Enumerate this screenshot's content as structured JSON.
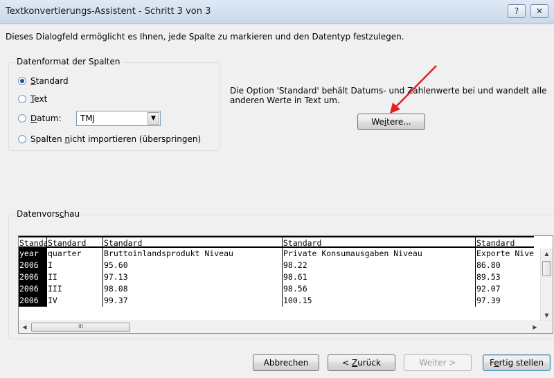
{
  "window": {
    "title": "Textkonvertierungs-Assistent - Schritt 3 von 3",
    "help_label": "?",
    "close_label": "✕"
  },
  "intro": "Dieses Dialogfeld ermöglicht es Ihnen, jede Spalte zu markieren und den Datentyp festzulegen.",
  "format_group": {
    "legend": "Datenformat der Spalten",
    "options": [
      {
        "pre": "",
        "key": "S",
        "post": "tandard",
        "selected": true
      },
      {
        "pre": "",
        "key": "T",
        "post": "ext",
        "selected": false
      },
      {
        "pre": "",
        "key": "D",
        "post": "atum:",
        "selected": false
      },
      {
        "pre": "Spalten ",
        "key": "n",
        "post": "icht importieren (überspringen)",
        "selected": false
      }
    ],
    "date_format": "TMJ"
  },
  "info_text": "Die Option 'Standard' behält Datums- und Zahlenwerte bei und wandelt alle anderen Werte in Text um.",
  "more_button": {
    "pre": "We",
    "key": "i",
    "post": "tere..."
  },
  "preview_group": {
    "pre": "Datenvors",
    "key": "c",
    "post": "hau"
  },
  "preview": {
    "headers": [
      "Standard",
      "Standard",
      "Standard",
      "Standard",
      "Standard"
    ],
    "rows": [
      [
        "year",
        "quarter",
        "Bruttoinlandsprodukt Niveau",
        "Private Konsumausgaben Niveau",
        "Exporte Niveau"
      ],
      [
        "2006",
        "I",
        "95.60",
        "98.22",
        "86.80"
      ],
      [
        "2006",
        "II",
        "97.13",
        "98.61",
        "89.53"
      ],
      [
        "2006",
        "III",
        "98.08",
        "98.56",
        "92.07"
      ],
      [
        "2006",
        "IV",
        "99.37",
        "100.15",
        "97.39"
      ]
    ],
    "hscroll_grip": "III"
  },
  "buttons": {
    "cancel": "Abbrechen",
    "back_pre": "< ",
    "back_key": "Z",
    "back_post": "urück",
    "next": "Weiter >",
    "finish_pre": "F",
    "finish_key": "e",
    "finish_post": "rtig stellen"
  },
  "annotation_color": "#e02020"
}
